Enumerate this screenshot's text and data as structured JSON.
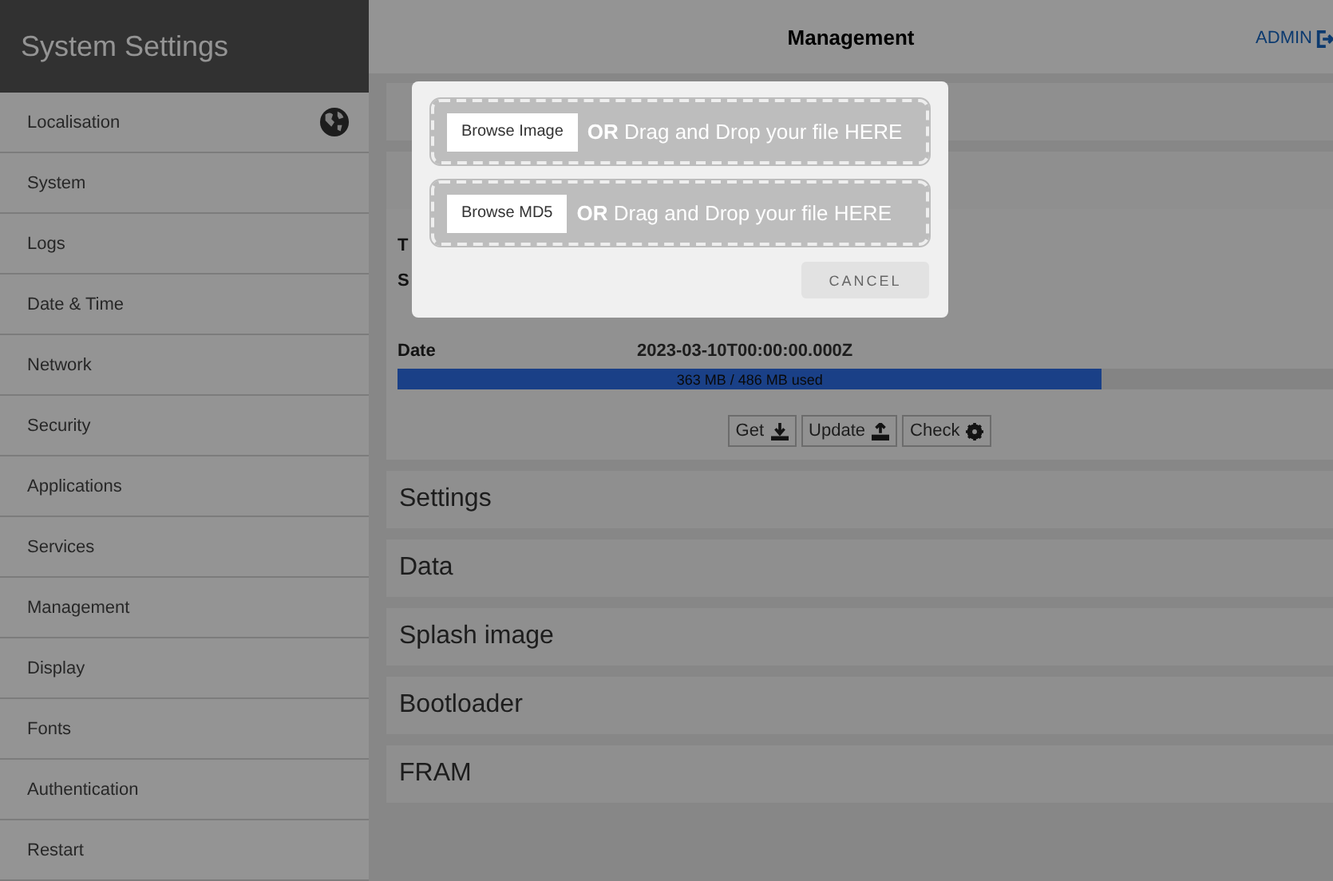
{
  "sidebar": {
    "title": "System Settings",
    "items": [
      {
        "label": "Localisation",
        "globe": true
      },
      {
        "label": "System"
      },
      {
        "label": "Logs"
      },
      {
        "label": "Date & Time"
      },
      {
        "label": "Network"
      },
      {
        "label": "Security"
      },
      {
        "label": "Applications"
      },
      {
        "label": "Services"
      },
      {
        "label": "Management"
      },
      {
        "label": "Display"
      },
      {
        "label": "Fonts"
      },
      {
        "label": "Authentication"
      },
      {
        "label": "Restart"
      }
    ]
  },
  "header": {
    "title": "Management",
    "user": "ADMIN"
  },
  "sections": [
    {
      "expanded": false
    },
    {
      "expanded": true,
      "details": [
        {
          "label": "T"
        },
        {
          "label": "S"
        },
        {
          "label": "Date",
          "value": "2023-03-10T00:00:00.000Z"
        }
      ],
      "storage": {
        "level": 0.753,
        "text": "363 MB / 486 MB used"
      },
      "actions": [
        {
          "label": "Get",
          "kind": "download"
        },
        {
          "label": "Update",
          "kind": "upload"
        },
        {
          "label": "Check",
          "kind": "settings"
        }
      ]
    },
    {
      "title": "Settings",
      "expanded": false
    },
    {
      "title": "Data",
      "expanded": false
    },
    {
      "title": "Splash image",
      "expanded": false
    },
    {
      "title": "Bootloader",
      "expanded": false
    },
    {
      "title": "FRAM",
      "expanded": false
    }
  ],
  "modal": {
    "dropzones": [
      {
        "button": "Browse Image",
        "or": "OR",
        "text": "Drag and Drop your file HERE"
      },
      {
        "button": "Browse MD5",
        "or": "OR",
        "text": "Drag and Drop your file HERE"
      }
    ],
    "cancel": "CANCEL"
  }
}
